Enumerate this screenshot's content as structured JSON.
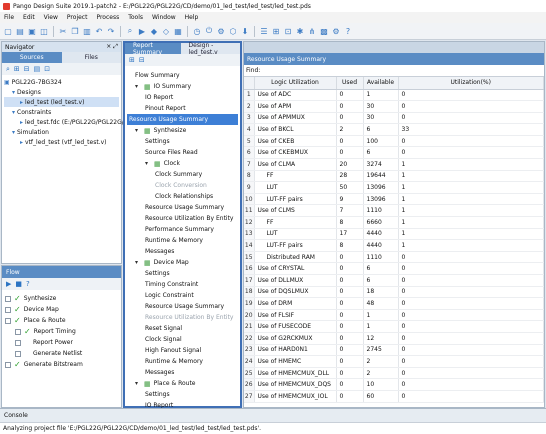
{
  "window": {
    "title": "Pango Design Suite 2019.1-patch2 - E:/PGL22G/PGL22G/CD/demo/01_led_test/led_test/led_test.pds"
  },
  "menu": [
    "File",
    "Edit",
    "View",
    "Project",
    "Process",
    "Tools",
    "Window",
    "Help"
  ],
  "navigator": {
    "title": "Navigator",
    "tabs": [
      "Sources",
      "Files"
    ],
    "tree": [
      {
        "label": "PGL22G-7BG324",
        "depth": 0
      },
      {
        "label": "Designs",
        "depth": 1
      },
      {
        "label": "led_test (led_test.v)",
        "depth": 2,
        "selected": true
      },
      {
        "label": "Constraints",
        "depth": 1
      },
      {
        "label": "led_test.fdc (E:/PGL22G/PGL22G/CD/demo)",
        "depth": 2
      },
      {
        "label": "Simulation",
        "depth": 1
      },
      {
        "label": "vtf_led_test (vtf_led_test.v)",
        "depth": 2
      }
    ]
  },
  "flow": {
    "title": "Flow",
    "items": [
      {
        "label": "Synthesize",
        "depth": 0,
        "ok": true
      },
      {
        "label": "Device Map",
        "depth": 0,
        "ok": true
      },
      {
        "label": "Place & Route",
        "depth": 0,
        "ok": true
      },
      {
        "label": "Report Timing",
        "depth": 1,
        "ok": true
      },
      {
        "label": "Report Power",
        "depth": 1,
        "ok": false
      },
      {
        "label": "Generate Netlist",
        "depth": 1,
        "ok": false
      },
      {
        "label": "Generate Bitstream",
        "depth": 0,
        "ok": true
      }
    ]
  },
  "editor": {
    "tabs": [
      "Report Summary",
      "Design - led_test.v"
    ],
    "report_list": [
      {
        "label": "Flow Summary",
        "depth": 0
      },
      {
        "label": "IO Summary",
        "depth": 0,
        "group": true
      },
      {
        "label": "IO Report",
        "depth": 1
      },
      {
        "label": "Pinout Report",
        "depth": 1
      },
      {
        "label": "Resource Usage Summary",
        "depth": 0,
        "selected": true
      },
      {
        "label": "Synthesize",
        "depth": 0,
        "group": true
      },
      {
        "label": "Settings",
        "depth": 1
      },
      {
        "label": "Source Files Read",
        "depth": 1
      },
      {
        "label": "Clock",
        "depth": 1,
        "group": true
      },
      {
        "label": "Clock Summary",
        "depth": 2
      },
      {
        "label": "Clock Conversion",
        "depth": 2,
        "disabled": true
      },
      {
        "label": "Clock Relationships",
        "depth": 2
      },
      {
        "label": "Resource Usage Summary",
        "depth": 1
      },
      {
        "label": "Resource Utilization By Entity",
        "depth": 1
      },
      {
        "label": "Performance Summary",
        "depth": 1
      },
      {
        "label": "Runtime & Memory",
        "depth": 1
      },
      {
        "label": "Messages",
        "depth": 1
      },
      {
        "label": "Device Map",
        "depth": 0,
        "group": true
      },
      {
        "label": "Settings",
        "depth": 1
      },
      {
        "label": "Timing Constraint",
        "depth": 1
      },
      {
        "label": "Logic Constraint",
        "depth": 1
      },
      {
        "label": "Resource Usage Summary",
        "depth": 1
      },
      {
        "label": "Resource Utilization By Entity",
        "depth": 1,
        "disabled": true
      },
      {
        "label": "Reset Signal",
        "depth": 1
      },
      {
        "label": "Clock Signal",
        "depth": 1
      },
      {
        "label": "High Fanout Signal",
        "depth": 1
      },
      {
        "label": "Runtime & Memory",
        "depth": 1
      },
      {
        "label": "Messages",
        "depth": 1
      },
      {
        "label": "Place & Route",
        "depth": 0,
        "group": true
      },
      {
        "label": "Settings",
        "depth": 1
      },
      {
        "label": "IO Report",
        "depth": 1
      }
    ]
  },
  "resource": {
    "title": "Resource Usage Summary",
    "find_label": "Find:",
    "columns": [
      "",
      "Logic Utilization",
      "Used",
      "Available",
      "Utilization(%)"
    ],
    "rows": [
      [
        "1",
        "Use of ADC",
        "0",
        "1",
        "0"
      ],
      [
        "2",
        "Use of APM",
        "0",
        "30",
        "0"
      ],
      [
        "3",
        "Use of APMMUX",
        "0",
        "30",
        "0"
      ],
      [
        "4",
        "Use of BKCL",
        "2",
        "6",
        "33"
      ],
      [
        "5",
        "Use of CKEB",
        "0",
        "100",
        "0"
      ],
      [
        "6",
        "Use of CKEBMUX",
        "0",
        "6",
        "0"
      ],
      [
        "7",
        "Use of CLMA",
        "20",
        "3274",
        "1"
      ],
      [
        "8",
        "  FF",
        "28",
        "19644",
        "1"
      ],
      [
        "9",
        "  LUT",
        "50",
        "13096",
        "1"
      ],
      [
        "10",
        "  LUT-FF pairs",
        "9",
        "13096",
        "1"
      ],
      [
        "11",
        "Use of CLMS",
        "7",
        "1110",
        "1"
      ],
      [
        "12",
        "  FF",
        "8",
        "6660",
        "1"
      ],
      [
        "13",
        "  LUT",
        "17",
        "4440",
        "1"
      ],
      [
        "14",
        "  LUT-FF pairs",
        "8",
        "4440",
        "1"
      ],
      [
        "15",
        "  Distributed RAM",
        "0",
        "1110",
        "0"
      ],
      [
        "16",
        "Use of CRYSTAL",
        "0",
        "6",
        "0"
      ],
      [
        "17",
        "Use of DLLMUX",
        "0",
        "6",
        "0"
      ],
      [
        "18",
        "Use of DQSLMUX",
        "0",
        "18",
        "0"
      ],
      [
        "19",
        "Use of DRM",
        "0",
        "48",
        "0"
      ],
      [
        "20",
        "Use of FLSIF",
        "0",
        "1",
        "0"
      ],
      [
        "21",
        "Use of FUSECODE",
        "0",
        "1",
        "0"
      ],
      [
        "22",
        "Use of G2RCKMUX",
        "0",
        "12",
        "0"
      ],
      [
        "23",
        "Use of HARD0N1",
        "0",
        "2745",
        "0"
      ],
      [
        "24",
        "Use of HMEMC",
        "0",
        "2",
        "0"
      ],
      [
        "25",
        "Use of HMEMCMUX_DLL",
        "0",
        "2",
        "0"
      ],
      [
        "26",
        "Use of HMEMCMUX_DQS",
        "0",
        "10",
        "0"
      ],
      [
        "27",
        "Use of HMEMCMUX_IOL",
        "0",
        "60",
        "0"
      ]
    ]
  },
  "console": {
    "title": "Console",
    "text": "Analyzing project file 'E:/PGL22G/PGL22G/CD/demo/01_led_test/led_test/led_test.pds'."
  }
}
